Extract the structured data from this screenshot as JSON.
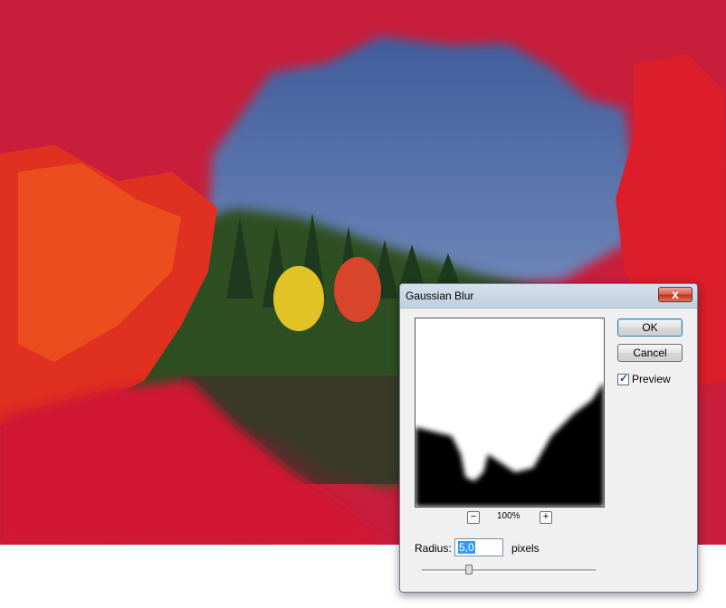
{
  "dialog": {
    "title": "Gaussian Blur",
    "close_label": "x",
    "ok_label": "OK",
    "cancel_label": "Cancel",
    "preview_label": "Preview",
    "preview_checked": true,
    "zoom_out_label": "−",
    "zoom_in_label": "+",
    "zoom_value": "100%",
    "radius_label": "Radius:",
    "radius_value": "5,0",
    "radius_unit": "pixels",
    "slider_level": 0.27
  },
  "colors": {
    "mask_red": "#d8142c",
    "sky_blue": "#4a6aa6",
    "accent_blue": "#3399ff"
  },
  "icons": {
    "close": "close-icon",
    "checkmark": "checkmark-icon"
  }
}
